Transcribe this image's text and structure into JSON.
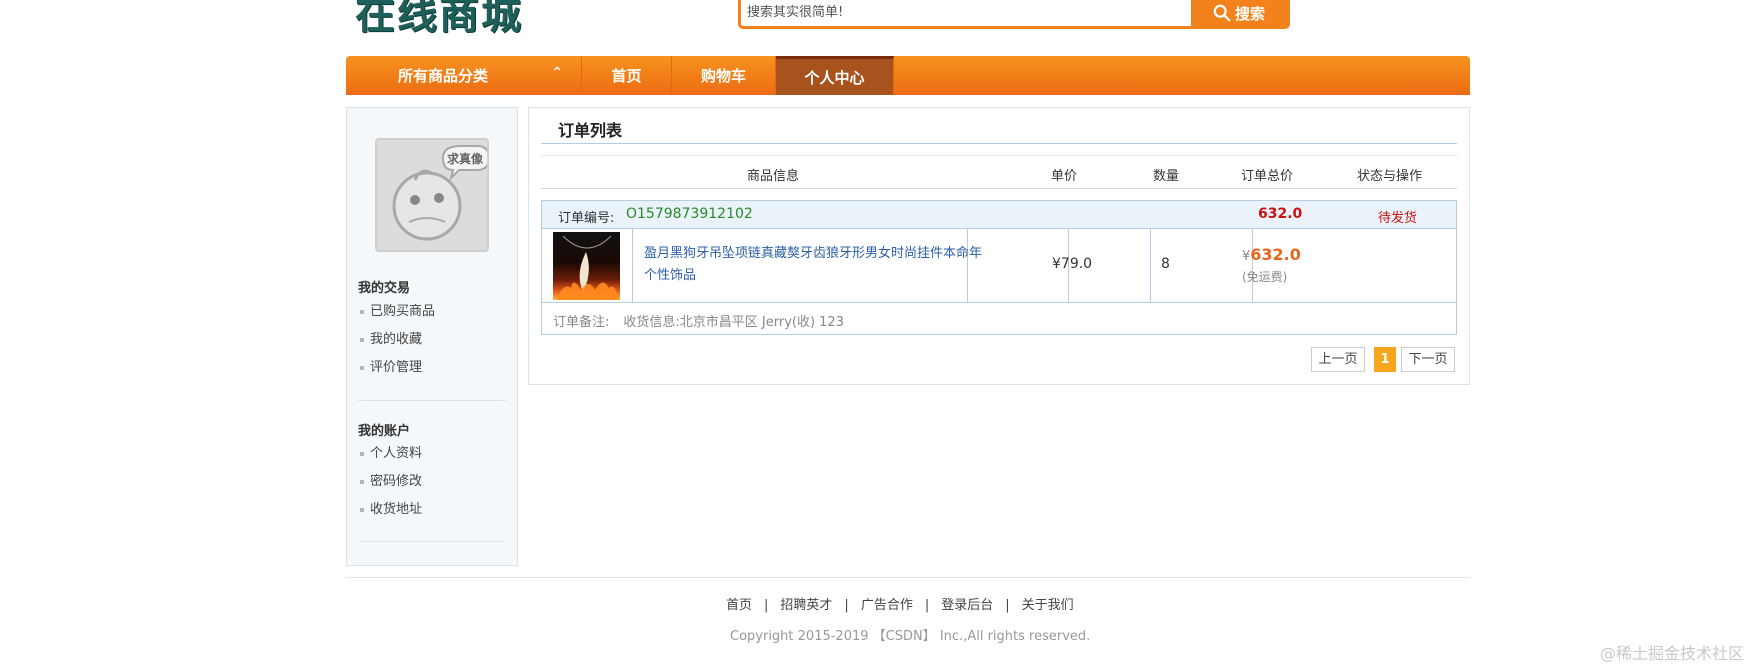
{
  "header": {
    "logo_text": "在线商城",
    "search": {
      "placeholder": "搜索其实很简单!",
      "button_label": "搜索"
    }
  },
  "nav": {
    "categories_label": "所有商品分类",
    "items": [
      {
        "label": "首页"
      },
      {
        "label": "购物车"
      },
      {
        "label": "个人中心",
        "active": true
      }
    ]
  },
  "sidebar": {
    "avatar_caption": "求真像",
    "sections": [
      {
        "title": "我的交易",
        "items": [
          "已购买商品",
          "我的收藏",
          "评价管理"
        ]
      },
      {
        "title": "我的账户",
        "items": [
          "个人资料",
          "密码修改",
          "收货地址"
        ]
      }
    ]
  },
  "main": {
    "title": "订单列表",
    "columns": [
      "商品信息",
      "单价",
      "数量",
      "订单总价",
      "状态与操作"
    ],
    "order": {
      "number_label": "订单编号:",
      "number": "O1579873912102",
      "total": "632.0",
      "status": "待发货",
      "item": {
        "name": "盈月黑狗牙吊坠项链真藏獒牙齿狼牙形男女时尚挂件本命年个性饰品",
        "price": "¥79.0",
        "quantity": "8",
        "total_symbol": "¥",
        "total": "632.0",
        "shipping_note": "(免运费)"
      },
      "remark_label": "订单备注:",
      "address": "收货信息:北京市昌平区 Jerry(收) 123"
    },
    "pagination": {
      "prev": "上一页",
      "current": "1",
      "next": "下一页"
    }
  },
  "footer": {
    "links": [
      "首页",
      "招聘英才",
      "广告合作",
      "登录后台",
      "关于我们"
    ],
    "copyright": "Copyright 2015-2019 【CSDN】 Inc.,All rights reserved."
  },
  "watermark": "@稀土掘金技术社区",
  "colors": {
    "nav_orange": "#f3821d",
    "nav_active": "#a8521e",
    "price_red": "#cc1111",
    "total_orange": "#e8661b",
    "link_blue": "#2a5ea8",
    "order_no_green": "#2a8a2a"
  }
}
